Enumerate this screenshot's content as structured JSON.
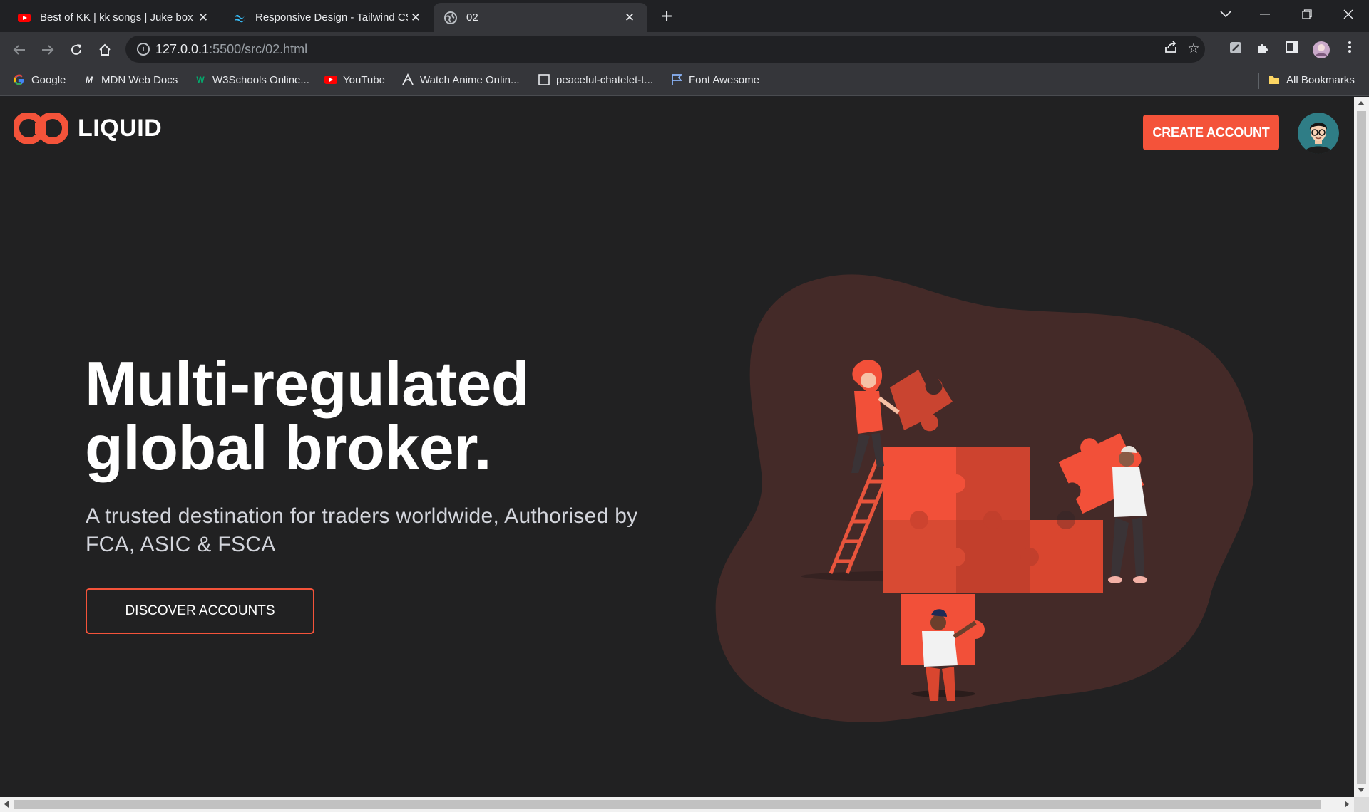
{
  "browser": {
    "tabs": [
      {
        "title": "Best of KK | kk songs | Juke box |",
        "favicon": "youtube-icon",
        "active": false
      },
      {
        "title": "Responsive Design - Tailwind CSS",
        "favicon": "tailwind-icon",
        "active": false
      },
      {
        "title": "02",
        "favicon": "globe-icon",
        "active": true
      }
    ],
    "url_host": "127.0.0.1",
    "url_path": ":5500/src/02.html",
    "bookmarks": [
      {
        "label": "Google",
        "icon": "google-icon"
      },
      {
        "label": "MDN Web Docs",
        "icon": "mdn-icon"
      },
      {
        "label": "W3Schools Online...",
        "icon": "w3schools-icon"
      },
      {
        "label": "YouTube",
        "icon": "youtube-icon"
      },
      {
        "label": "Watch Anime Onlin...",
        "icon": "anime-icon"
      },
      {
        "label": "peaceful-chatelet-t...",
        "icon": "page-icon"
      },
      {
        "label": "Font Awesome",
        "icon": "flag-icon"
      }
    ],
    "all_bookmarks": "All Bookmarks"
  },
  "site": {
    "brand": "LIQUID",
    "create_account": "CREATE ACCOUNT",
    "hero": {
      "title_line1": "Multi-regulated",
      "title_line2": "global broker.",
      "subtitle": "A trusted destination for traders worldwide, Authorised by FCA, ASIC & FSCA",
      "cta": "DISCOVER ACCOUNTS"
    },
    "colors": {
      "accent": "#f4533a",
      "background": "#212122",
      "blob": "#442a28"
    }
  }
}
